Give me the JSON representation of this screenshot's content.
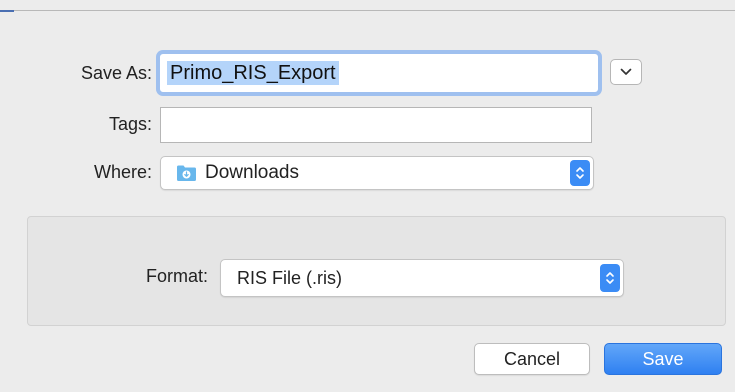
{
  "dialog": {
    "save_as_label": "Save As:",
    "save_as_value": "Primo_RIS_Export",
    "tags_label": "Tags:",
    "tags_value": "",
    "where_label": "Where:",
    "where_value": "Downloads",
    "format_label": "Format:",
    "format_value": "RIS File (.ris)",
    "cancel_label": "Cancel",
    "save_label": "Save"
  },
  "colors": {
    "accent": "#3b8cf5",
    "selection": "#b4d4fa",
    "panel": "#e5e5e5"
  },
  "icons": {
    "expand": "chevron-down-icon",
    "folder": "downloads-folder-icon",
    "stepper": "up-down-stepper-icon"
  }
}
